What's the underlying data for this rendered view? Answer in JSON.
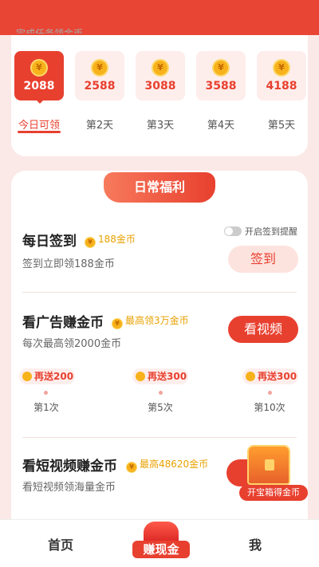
{
  "header": {
    "partial_text": "完成任务领金币"
  },
  "checkin_days": [
    {
      "amount": "2088",
      "label": "今日可领",
      "active": true
    },
    {
      "amount": "2588",
      "label": "第2天",
      "active": false
    },
    {
      "amount": "3088",
      "label": "第3天",
      "active": false
    },
    {
      "amount": "3588",
      "label": "第4天",
      "active": false
    },
    {
      "amount": "4188",
      "label": "第5天",
      "active": false
    }
  ],
  "daily": {
    "section_title": "日常福利",
    "signin": {
      "title": "每日签到",
      "tag": "188金币",
      "sub": "签到立即领188金币",
      "toggle_label": "开启签到提醒",
      "button": "签到"
    },
    "ads": {
      "title": "看广告赚金币",
      "tag": "最高领3万金币",
      "sub": "每次最高领2000金币",
      "button": "看视频",
      "bonuses": [
        {
          "text": "再送200",
          "times": "第1次"
        },
        {
          "text": "再送300",
          "times": "第5次"
        },
        {
          "text": "再送300",
          "times": "第10次"
        }
      ]
    },
    "video": {
      "title": "看短视频赚金币",
      "tag": "最高48620金币",
      "sub": "看短视频领海量金币",
      "chest_label": "开宝箱得金币"
    }
  },
  "nav": {
    "home": "首页",
    "center": "赚现金",
    "me": "我"
  },
  "colors": {
    "accent": "#e8402f",
    "gold": "#f7b21c"
  }
}
